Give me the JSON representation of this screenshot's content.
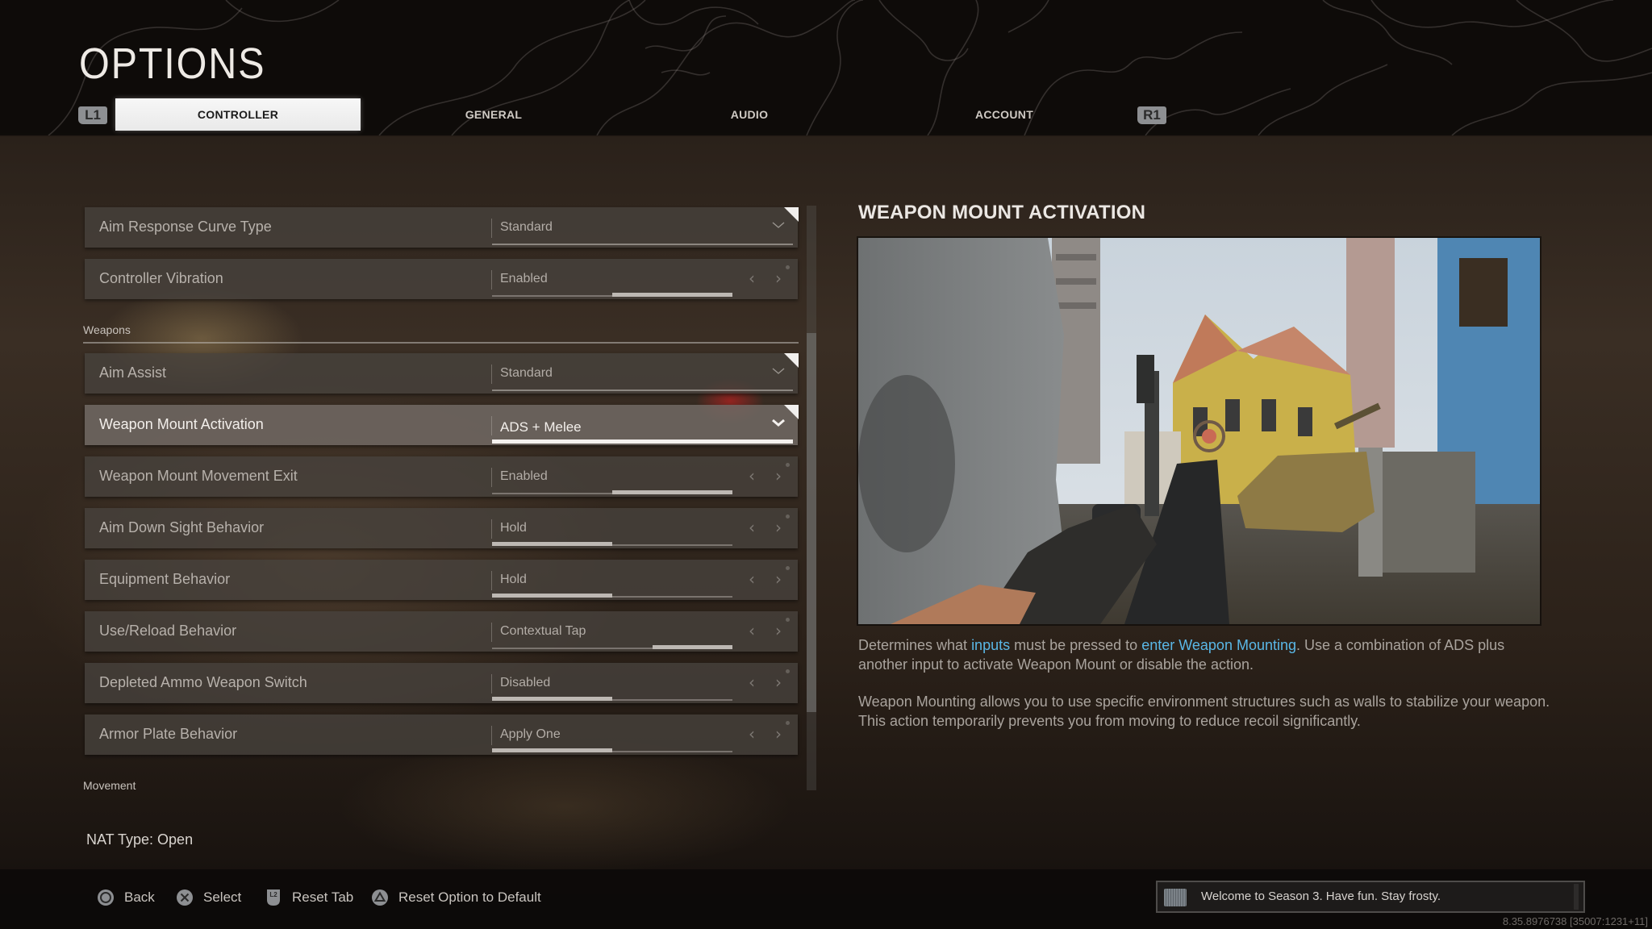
{
  "header": {
    "title": "OPTIONS",
    "left_bumper": "L1",
    "right_bumper": "R1",
    "tabs": [
      {
        "label": "CONTROLLER",
        "active": true
      },
      {
        "label": "GENERAL",
        "active": false
      },
      {
        "label": "AUDIO",
        "active": false
      },
      {
        "label": "ACCOUNT",
        "active": false
      }
    ]
  },
  "settings": {
    "sections": {
      "weapons": "Weapons",
      "movement": "Movement"
    },
    "rows": [
      {
        "label": "Aim Response Curve Type",
        "value": "Standard",
        "control": "dropdown",
        "icon": "chevron-down-icon"
      },
      {
        "label": "Controller Vibration",
        "value": "Enabled",
        "control": "selector",
        "option_index": 2,
        "option_count": 2
      },
      {
        "label": "Aim Assist",
        "value": "Standard",
        "control": "dropdown",
        "icon": "chevron-down-icon"
      },
      {
        "label": "Weapon Mount Activation",
        "value": "ADS + Melee",
        "control": "dropdown",
        "icon": "chevron-down-icon",
        "selected": true
      },
      {
        "label": "Weapon Mount Movement Exit",
        "value": "Enabled",
        "control": "selector",
        "option_index": 2,
        "option_count": 2
      },
      {
        "label": "Aim Down Sight Behavior",
        "value": "Hold",
        "control": "selector",
        "option_index": 1,
        "option_count": 2
      },
      {
        "label": "Equipment Behavior",
        "value": "Hold",
        "control": "selector",
        "option_index": 1,
        "option_count": 2
      },
      {
        "label": "Use/Reload Behavior",
        "value": "Contextual Tap",
        "control": "selector",
        "option_index": 3,
        "option_count": 3
      },
      {
        "label": "Depleted Ammo Weapon Switch",
        "value": "Disabled",
        "control": "selector",
        "option_index": 1,
        "option_count": 2
      },
      {
        "label": "Armor Plate Behavior",
        "value": "Apply One",
        "control": "selector",
        "option_index": 1,
        "option_count": 2
      }
    ],
    "arrow_left": "‹",
    "arrow_right": "›",
    "scroll_position": 0.22
  },
  "nat_type": "NAT Type: Open",
  "detail": {
    "title": "WEAPON MOUNT ACTIVATION",
    "image_alt": "Gameplay preview: first-person view mounting a rifle against a wall in a city street with a tank and yellow building",
    "paragraph1": {
      "t1": "Determines what ",
      "h1": "inputs",
      "t2": " must be pressed to ",
      "h2": "enter Weapon Mounting",
      "t3": ". Use a combination of ADS plus another input to activate Weapon Mount or disable the action."
    },
    "paragraph2": "Weapon Mounting allows you to use specific environment structures such as walls to stabilize your weapon. This action temporarily prevents you from moving to reduce recoil significantly.",
    "highlight_color": "#5ab7e6"
  },
  "footer": {
    "prompts": [
      {
        "button": "circle-button-icon",
        "label": "Back"
      },
      {
        "button": "cross-button-icon",
        "label": "Select"
      },
      {
        "button": "l2-trigger-icon",
        "label": "Reset Tab"
      },
      {
        "button": "triangle-button-icon",
        "label": "Reset Option to Default"
      }
    ],
    "l2_text": "L2",
    "toast": "Welcome to Season 3. Have fun. Stay frosty.",
    "version": "8.35.8976738 [35007:1231+11]"
  }
}
